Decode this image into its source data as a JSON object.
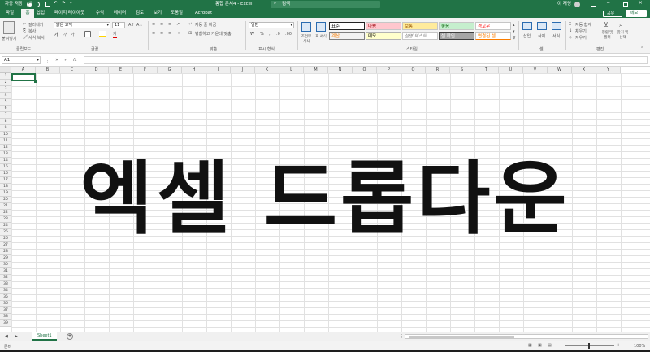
{
  "titlebar": {
    "autosave_label": "자동 저장",
    "autosave_state": "끔",
    "doc_title": "통합 문서4 - Excel",
    "search_placeholder": "검색",
    "user_name": "이 재영"
  },
  "tabs": [
    "파일",
    "홈",
    "삽입",
    "페이지 레이아웃",
    "수식",
    "데이터",
    "검토",
    "보기",
    "도움말",
    "Acrobat"
  ],
  "tab_right": {
    "share": "공유",
    "comment": "메모"
  },
  "ribbon": {
    "clipboard": {
      "paste": "붙여넣기",
      "cut": "잘라내기",
      "copy": "복사",
      "format_painter": "서식 복사",
      "group": "클립보드"
    },
    "font": {
      "name": "맑은 고딕",
      "size": "11",
      "group": "글꼴"
    },
    "align": {
      "wrap": "자동 줄 바꿈",
      "merge": "병합하고 가운데 맞춤",
      "group": "맞춤"
    },
    "number": {
      "format": "일반",
      "group": "표시 형식"
    },
    "styles": {
      "cond": "조건부 서식",
      "table": "표 서식",
      "cells": [
        [
          "표준",
          "나쁨",
          "보통",
          "좋음",
          "경고문"
        ],
        [
          "계산",
          "메모",
          "설명 텍스트",
          "셀 확인",
          "연결된 셀"
        ]
      ],
      "group": "스타일"
    },
    "cells": {
      "insert": "삽입",
      "delete": "삭제",
      "format": "서식",
      "group": "셀"
    },
    "editing": {
      "autosum": "자동 합계",
      "fill": "채우기",
      "clear": "지우기",
      "sort": "정렬 및 필터",
      "find": "찾기 및 선택",
      "group": "편집"
    }
  },
  "formulabar": {
    "namebox": "A1",
    "fx": "fx"
  },
  "columns": [
    "A",
    "B",
    "C",
    "D",
    "E",
    "F",
    "G",
    "H",
    "I",
    "J",
    "K",
    "L",
    "M",
    "N",
    "O",
    "P",
    "Q",
    "R",
    "S",
    "T",
    "U",
    "V",
    "W",
    "X",
    "Y"
  ],
  "overlay_text": "엑셀 드롭다운",
  "sheetbar": {
    "sheet": "Sheet1",
    "add": "+"
  },
  "statusbar": {
    "ready": "준비",
    "zoom": "100%"
  }
}
